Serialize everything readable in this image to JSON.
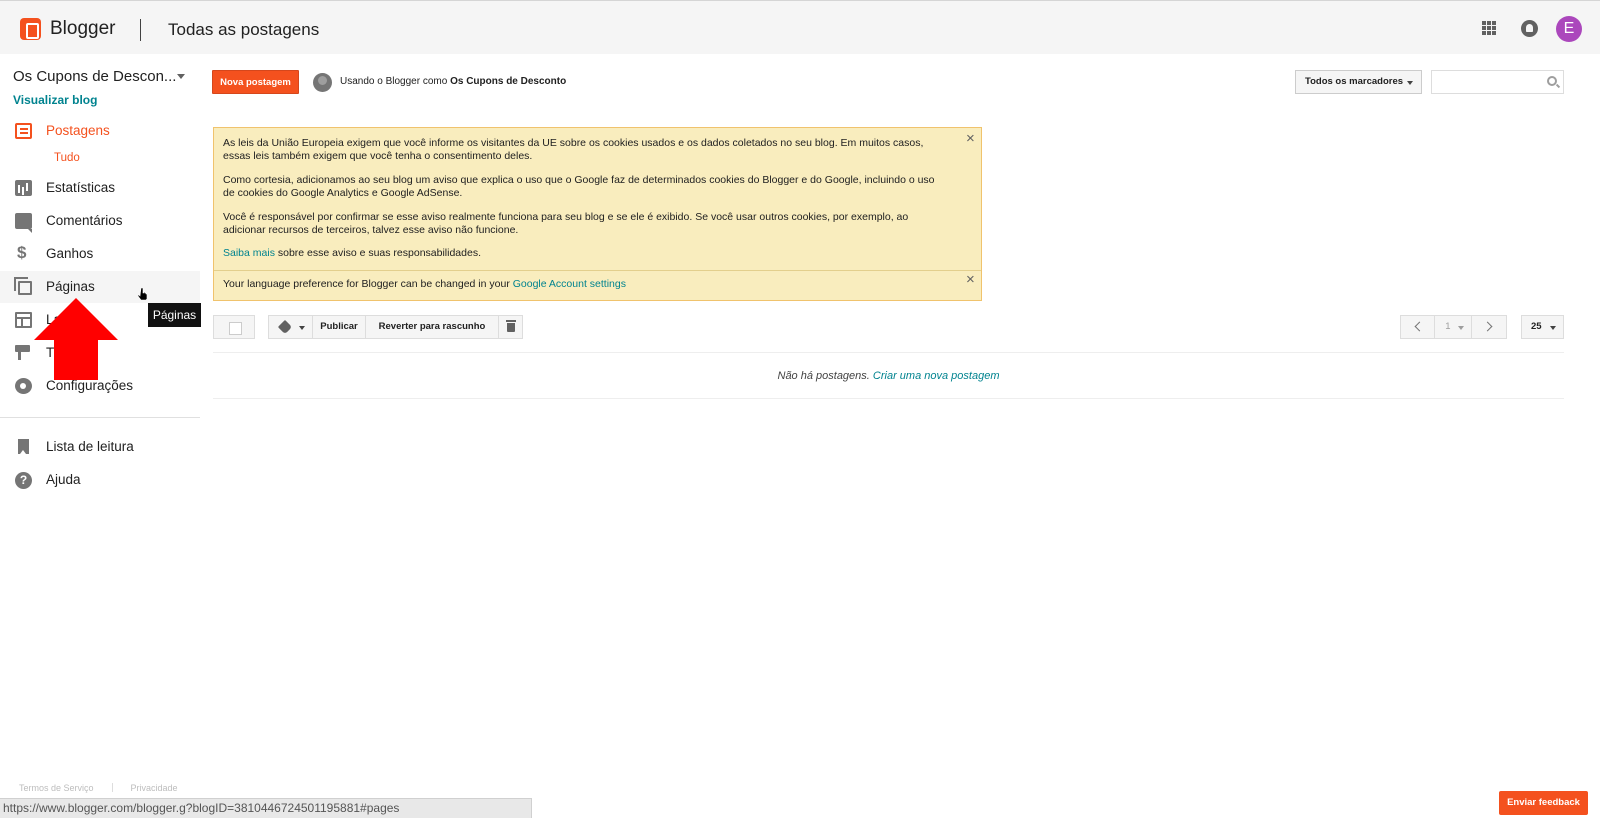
{
  "header": {
    "brand": "Blogger",
    "page_title": "Todas as postagens",
    "avatar_letter": "E"
  },
  "sidebar": {
    "blog_name": "Os Cupons de Descon...",
    "view_blog": "Visualizar blog",
    "items": [
      {
        "label": "Postagens",
        "icon": "posts-icon"
      },
      {
        "label": "Estatísticas",
        "icon": "stats-icon"
      },
      {
        "label": "Comentários",
        "icon": "comments-icon"
      },
      {
        "label": "Ganhos",
        "icon": "dollar-icon"
      },
      {
        "label": "Páginas",
        "icon": "pages-icon"
      },
      {
        "label": "La",
        "icon": "layout-icon"
      },
      {
        "label": "T",
        "icon": "theme-icon"
      },
      {
        "label": "Configurações",
        "icon": "gear-icon"
      },
      {
        "label": "Lista de leitura",
        "icon": "bookmark-icon"
      },
      {
        "label": "Ajuda",
        "icon": "help-icon"
      }
    ],
    "sub_item": "Tudo",
    "tooltip": "Páginas"
  },
  "toolbar": {
    "new_post": "Nova postagem",
    "using_prefix": "Usando o Blogger como",
    "using_name": "Os Cupons de Desconto",
    "labels_select": "Todos os marcadores",
    "search_placeholder": ""
  },
  "notice": {
    "p1": "As leis da União Europeia exigem que você informe os visitantes da UE sobre os cookies usados e os dados coletados no seu blog. Em muitos casos, essas leis também exigem que você tenha o consentimento deles.",
    "p2": "Como cortesia, adicionamos ao seu blog um aviso que explica o uso que o Google faz de determinados cookies do Blogger e do Google, incluindo o uso de cookies do Google Analytics e Google AdSense.",
    "p3": "Você é responsável por confirmar se esse aviso realmente funciona para seu blog e se ele é exibido. Se você usar outros cookies, por exemplo, ao adicionar recursos de terceiros, talvez esse aviso não funcione.",
    "p4_link": "Saiba mais",
    "p4_rest": " sobre esse aviso e suas responsabilidades.",
    "lang_text": "Your language preference for Blogger can be changed in your ",
    "lang_link": "Google Account settings"
  },
  "actions": {
    "publish": "Publicar",
    "revert": "Reverter para rascunho",
    "page_number": "1",
    "per_page": "25"
  },
  "empty": {
    "text": "Não há postagens.",
    "link": "Criar uma nova postagem"
  },
  "footer": {
    "terms": "Termos de Serviço",
    "privacy": "Privacidade",
    "status_url": "https://www.blogger.com/blogger.g?blogID=3810446724501195881#pages",
    "feedback": "Enviar feedback"
  },
  "colors": {
    "accent": "#f4511e",
    "link": "#00838f",
    "notice_bg": "#f9edbe",
    "arrow": "#ff0000"
  }
}
